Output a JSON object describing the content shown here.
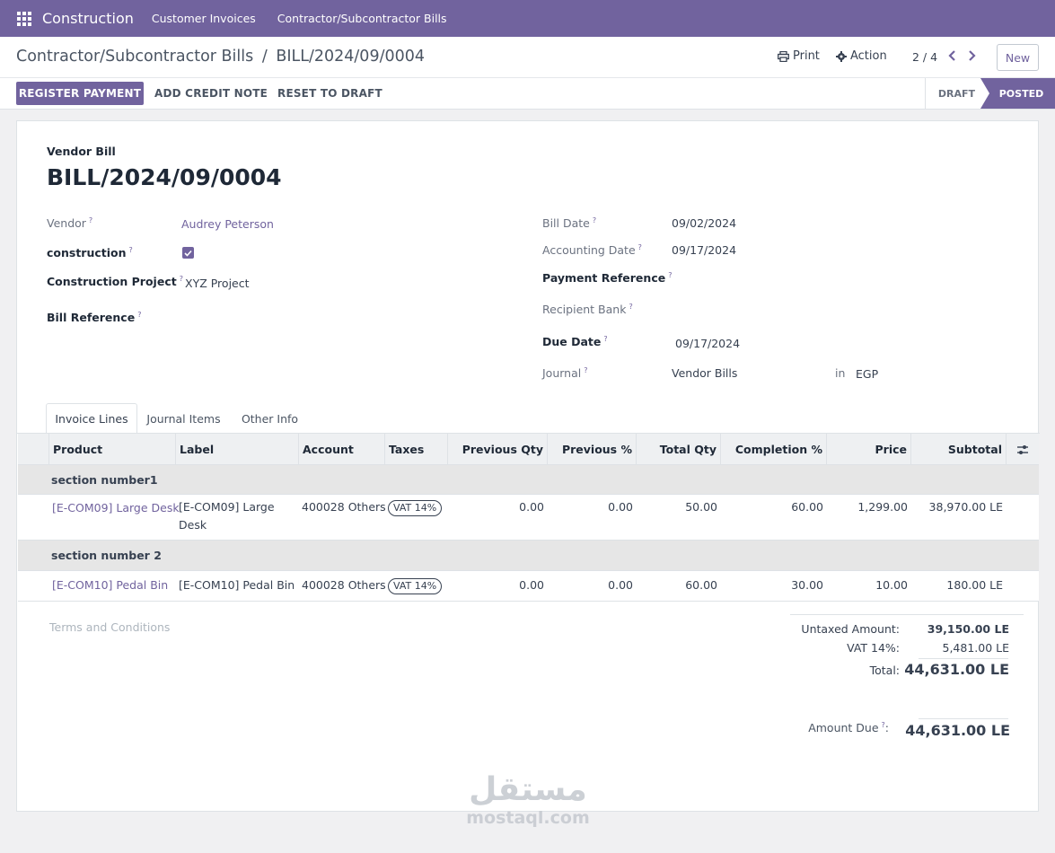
{
  "navbar": {
    "brand": "Construction",
    "menu": [
      "Customer Invoices",
      "Contractor/Subcontractor Bills"
    ]
  },
  "control_panel": {
    "breadcrumb_parent": "Contractor/Subcontractor Bills",
    "breadcrumb_sep": "/",
    "breadcrumb_current": "BILL/2024/09/0004",
    "print_label": "Print",
    "action_label": "Action",
    "pager": "2 / 4",
    "new_label": "New",
    "buttons": {
      "register_payment": "REGISTER PAYMENT",
      "add_credit_note": "ADD CREDIT NOTE",
      "reset_to_draft": "RESET TO DRAFT"
    },
    "status": {
      "draft": "DRAFT",
      "posted": "POSTED"
    }
  },
  "form": {
    "move_type": "Vendor Bill",
    "name": "BILL/2024/09/0004",
    "left": {
      "vendor_label": "Vendor",
      "vendor_value": "Audrey Peterson",
      "construction_label": "construction",
      "construction_checked": true,
      "project_label": "Construction Project",
      "project_value": "XYZ Project",
      "bill_ref_label": "Bill Reference"
    },
    "right": {
      "bill_date_label": "Bill Date",
      "bill_date_value": "09/02/2024",
      "accounting_date_label": "Accounting Date",
      "accounting_date_value": "09/17/2024",
      "payment_ref_label": "Payment Reference",
      "recipient_bank_label": "Recipient Bank",
      "due_date_label": "Due Date",
      "due_date_value": "09/17/2024",
      "journal_label": "Journal",
      "journal_value": "Vendor Bills",
      "journal_in": "in",
      "currency": "EGP"
    },
    "help_mark": "?"
  },
  "tabs": [
    "Invoice Lines",
    "Journal Items",
    "Other Info"
  ],
  "table": {
    "headers": {
      "product": "Product",
      "label": "Label",
      "account": "Account",
      "taxes": "Taxes",
      "prev_qty": "Previous Qty",
      "prev_pct": "Previous %",
      "total_qty": "Total Qty",
      "completion": "Completion %",
      "price": "Price",
      "subtotal": "Subtotal"
    },
    "sections": [
      "section number1",
      "section number 2"
    ],
    "lines": [
      {
        "product": "[E-COM09] Large Desk",
        "label_line1": "[E-COM09] Large",
        "label_line2": "Desk",
        "account": "400028 Others",
        "tax": "VAT 14%",
        "prev_qty": "0.00",
        "prev_pct": "0.00",
        "total_qty": "50.00",
        "completion": "60.00",
        "price": "1,299.00",
        "subtotal": "38,970.00 LE"
      },
      {
        "product": "[E-COM10] Pedal Bin",
        "label_line1": "[E-COM10] Pedal Bin",
        "label_line2": "",
        "account": "400028 Others",
        "tax": "VAT 14%",
        "prev_qty": "0.00",
        "prev_pct": "0.00",
        "total_qty": "60.00",
        "completion": "30.00",
        "price": "10.00",
        "subtotal": "180.00 LE"
      }
    ]
  },
  "terms_placeholder": "Terms and Conditions",
  "totals": {
    "untaxed_label": "Untaxed Amount:",
    "untaxed_value": "39,150.00 LE",
    "vat_label": "VAT 14%:",
    "vat_value": "5,481.00 LE",
    "total_label": "Total:",
    "total_value": "44,631.00 LE",
    "amount_due_label": "Amount Due",
    "amount_due_colon": ":",
    "amount_due_value": "44,631.00 LE"
  },
  "watermark": {
    "arabic": "مستقل",
    "latin": "mostaql.com"
  },
  "colors": {
    "brand": "#71639e",
    "navbar": "#71639e"
  }
}
